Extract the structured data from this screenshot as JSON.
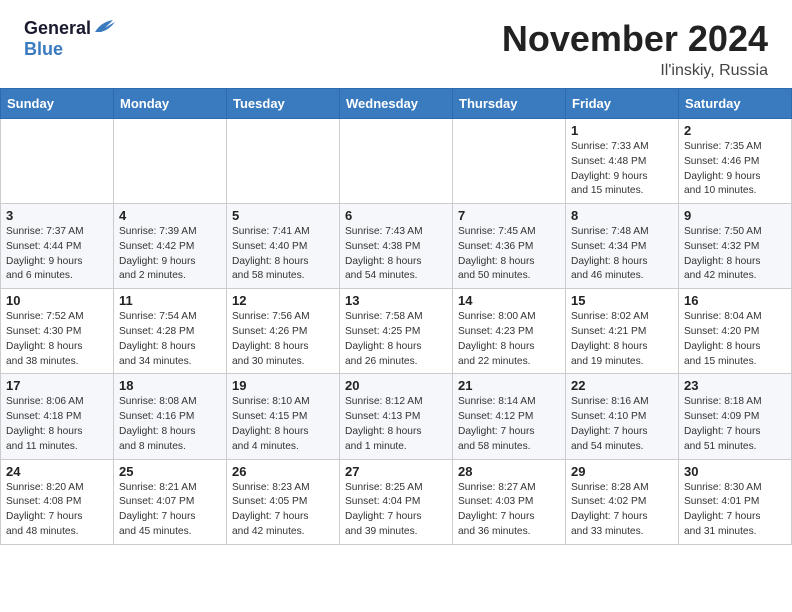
{
  "header": {
    "logo_general": "General",
    "logo_blue": "Blue",
    "month_title": "November 2024",
    "location": "Il'inskiy, Russia"
  },
  "weekdays": [
    "Sunday",
    "Monday",
    "Tuesday",
    "Wednesday",
    "Thursday",
    "Friday",
    "Saturday"
  ],
  "weeks": [
    [
      {
        "day": "",
        "info": ""
      },
      {
        "day": "",
        "info": ""
      },
      {
        "day": "",
        "info": ""
      },
      {
        "day": "",
        "info": ""
      },
      {
        "day": "",
        "info": ""
      },
      {
        "day": "1",
        "info": "Sunrise: 7:33 AM\nSunset: 4:48 PM\nDaylight: 9 hours\nand 15 minutes."
      },
      {
        "day": "2",
        "info": "Sunrise: 7:35 AM\nSunset: 4:46 PM\nDaylight: 9 hours\nand 10 minutes."
      }
    ],
    [
      {
        "day": "3",
        "info": "Sunrise: 7:37 AM\nSunset: 4:44 PM\nDaylight: 9 hours\nand 6 minutes."
      },
      {
        "day": "4",
        "info": "Sunrise: 7:39 AM\nSunset: 4:42 PM\nDaylight: 9 hours\nand 2 minutes."
      },
      {
        "day": "5",
        "info": "Sunrise: 7:41 AM\nSunset: 4:40 PM\nDaylight: 8 hours\nand 58 minutes."
      },
      {
        "day": "6",
        "info": "Sunrise: 7:43 AM\nSunset: 4:38 PM\nDaylight: 8 hours\nand 54 minutes."
      },
      {
        "day": "7",
        "info": "Sunrise: 7:45 AM\nSunset: 4:36 PM\nDaylight: 8 hours\nand 50 minutes."
      },
      {
        "day": "8",
        "info": "Sunrise: 7:48 AM\nSunset: 4:34 PM\nDaylight: 8 hours\nand 46 minutes."
      },
      {
        "day": "9",
        "info": "Sunrise: 7:50 AM\nSunset: 4:32 PM\nDaylight: 8 hours\nand 42 minutes."
      }
    ],
    [
      {
        "day": "10",
        "info": "Sunrise: 7:52 AM\nSunset: 4:30 PM\nDaylight: 8 hours\nand 38 minutes."
      },
      {
        "day": "11",
        "info": "Sunrise: 7:54 AM\nSunset: 4:28 PM\nDaylight: 8 hours\nand 34 minutes."
      },
      {
        "day": "12",
        "info": "Sunrise: 7:56 AM\nSunset: 4:26 PM\nDaylight: 8 hours\nand 30 minutes."
      },
      {
        "day": "13",
        "info": "Sunrise: 7:58 AM\nSunset: 4:25 PM\nDaylight: 8 hours\nand 26 minutes."
      },
      {
        "day": "14",
        "info": "Sunrise: 8:00 AM\nSunset: 4:23 PM\nDaylight: 8 hours\nand 22 minutes."
      },
      {
        "day": "15",
        "info": "Sunrise: 8:02 AM\nSunset: 4:21 PM\nDaylight: 8 hours\nand 19 minutes."
      },
      {
        "day": "16",
        "info": "Sunrise: 8:04 AM\nSunset: 4:20 PM\nDaylight: 8 hours\nand 15 minutes."
      }
    ],
    [
      {
        "day": "17",
        "info": "Sunrise: 8:06 AM\nSunset: 4:18 PM\nDaylight: 8 hours\nand 11 minutes."
      },
      {
        "day": "18",
        "info": "Sunrise: 8:08 AM\nSunset: 4:16 PM\nDaylight: 8 hours\nand 8 minutes."
      },
      {
        "day": "19",
        "info": "Sunrise: 8:10 AM\nSunset: 4:15 PM\nDaylight: 8 hours\nand 4 minutes."
      },
      {
        "day": "20",
        "info": "Sunrise: 8:12 AM\nSunset: 4:13 PM\nDaylight: 8 hours\nand 1 minute."
      },
      {
        "day": "21",
        "info": "Sunrise: 8:14 AM\nSunset: 4:12 PM\nDaylight: 7 hours\nand 58 minutes."
      },
      {
        "day": "22",
        "info": "Sunrise: 8:16 AM\nSunset: 4:10 PM\nDaylight: 7 hours\nand 54 minutes."
      },
      {
        "day": "23",
        "info": "Sunrise: 8:18 AM\nSunset: 4:09 PM\nDaylight: 7 hours\nand 51 minutes."
      }
    ],
    [
      {
        "day": "24",
        "info": "Sunrise: 8:20 AM\nSunset: 4:08 PM\nDaylight: 7 hours\nand 48 minutes."
      },
      {
        "day": "25",
        "info": "Sunrise: 8:21 AM\nSunset: 4:07 PM\nDaylight: 7 hours\nand 45 minutes."
      },
      {
        "day": "26",
        "info": "Sunrise: 8:23 AM\nSunset: 4:05 PM\nDaylight: 7 hours\nand 42 minutes."
      },
      {
        "day": "27",
        "info": "Sunrise: 8:25 AM\nSunset: 4:04 PM\nDaylight: 7 hours\nand 39 minutes."
      },
      {
        "day": "28",
        "info": "Sunrise: 8:27 AM\nSunset: 4:03 PM\nDaylight: 7 hours\nand 36 minutes."
      },
      {
        "day": "29",
        "info": "Sunrise: 8:28 AM\nSunset: 4:02 PM\nDaylight: 7 hours\nand 33 minutes."
      },
      {
        "day": "30",
        "info": "Sunrise: 8:30 AM\nSunset: 4:01 PM\nDaylight: 7 hours\nand 31 minutes."
      }
    ]
  ]
}
